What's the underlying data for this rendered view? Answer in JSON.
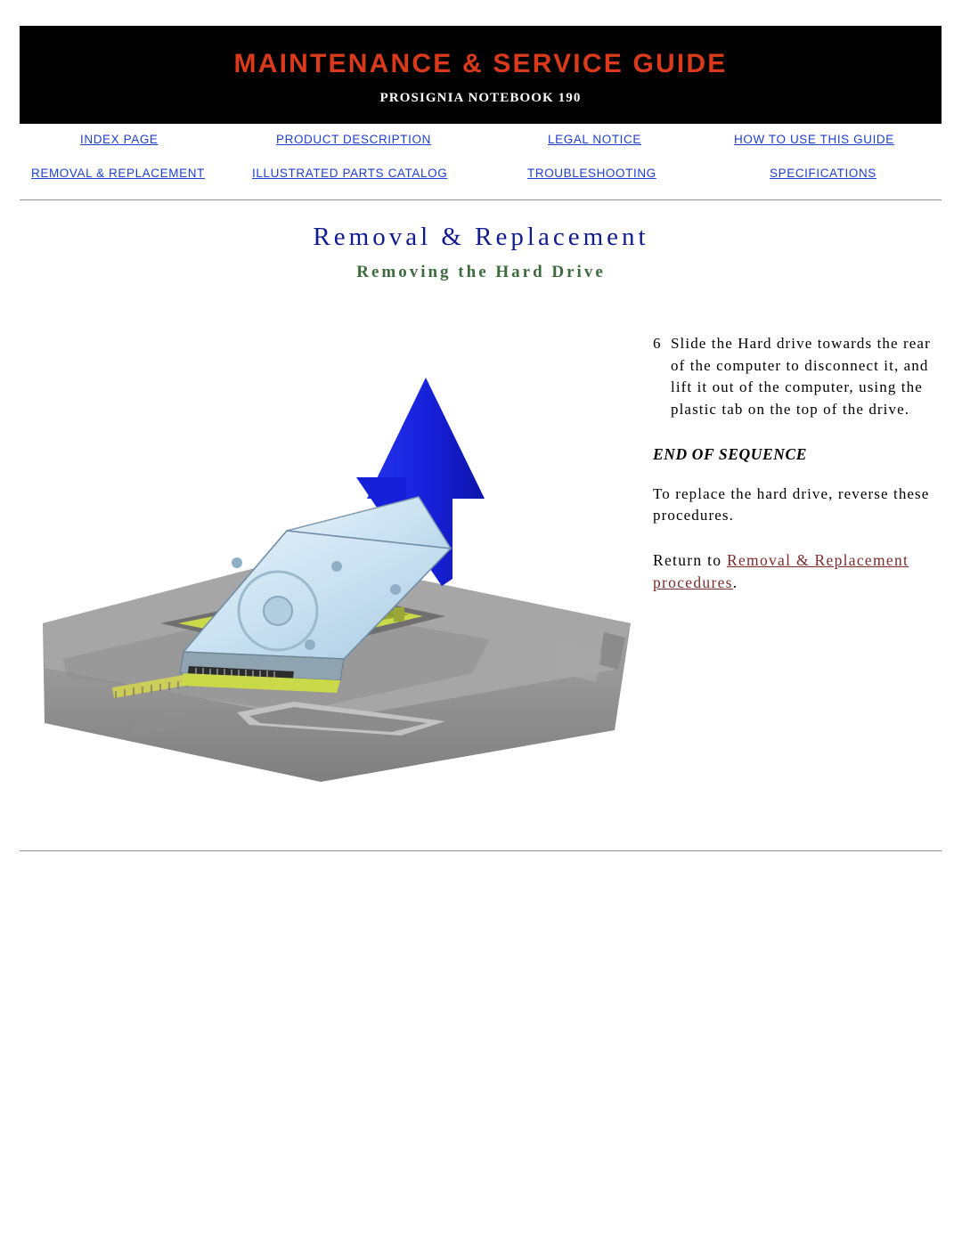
{
  "header": {
    "title": "MAINTENANCE & SERVICE GUIDE",
    "subtitle": "PROSIGNIA NOTEBOOK 190",
    "banner_bg": "#000000",
    "title_color": "#d93a1b"
  },
  "nav": {
    "row1": [
      {
        "label": "INDEX PAGE",
        "name": "nav-index-page"
      },
      {
        "label": "PRODUCT DESCRIPTION",
        "name": "nav-product-description"
      },
      {
        "label": "LEGAL NOTICE",
        "name": "nav-legal-notice"
      },
      {
        "label": "HOW TO USE THIS GUIDE",
        "name": "nav-how-to-use-this-guide"
      }
    ],
    "row2": [
      {
        "label": "REMOVAL & REPLACEMENT",
        "name": "nav-removal-replacement"
      },
      {
        "label": "ILLUSTRATED PARTS CATALOG",
        "name": "nav-illustrated-parts-catalog"
      },
      {
        "label": "TROUBLESHOOTING",
        "name": "nav-troubleshooting"
      },
      {
        "label": "SPECIFICATIONS",
        "name": "nav-specifications"
      }
    ],
    "link_color": "#1f3fcc"
  },
  "page": {
    "title": "Removal & Replacement",
    "subtitle": "Removing the Hard Drive",
    "title_color": "#111a8e",
    "subtitle_color": "#3d6b3d"
  },
  "content": {
    "step_number": "6",
    "step_text": "Slide the Hard drive towards the rear of the computer to disconnect it, and lift it out of the computer, using the plastic tab on the top of the drive.",
    "end_of_sequence": "END OF SEQUENCE",
    "replace_text": "To replace the hard drive, reverse these procedures.",
    "return_prefix": "Return to ",
    "return_link": "Removal & Replacement procedures",
    "return_suffix": ".",
    "return_link_color": "#7a2b2b"
  },
  "illustration": {
    "alt": "Hard drive being lifted out of notebook chassis with blue up arrow",
    "arrow_color": "#1a2ff0",
    "drive_color": "#cfe4f2",
    "chassis_color": "#9a9a9a"
  }
}
